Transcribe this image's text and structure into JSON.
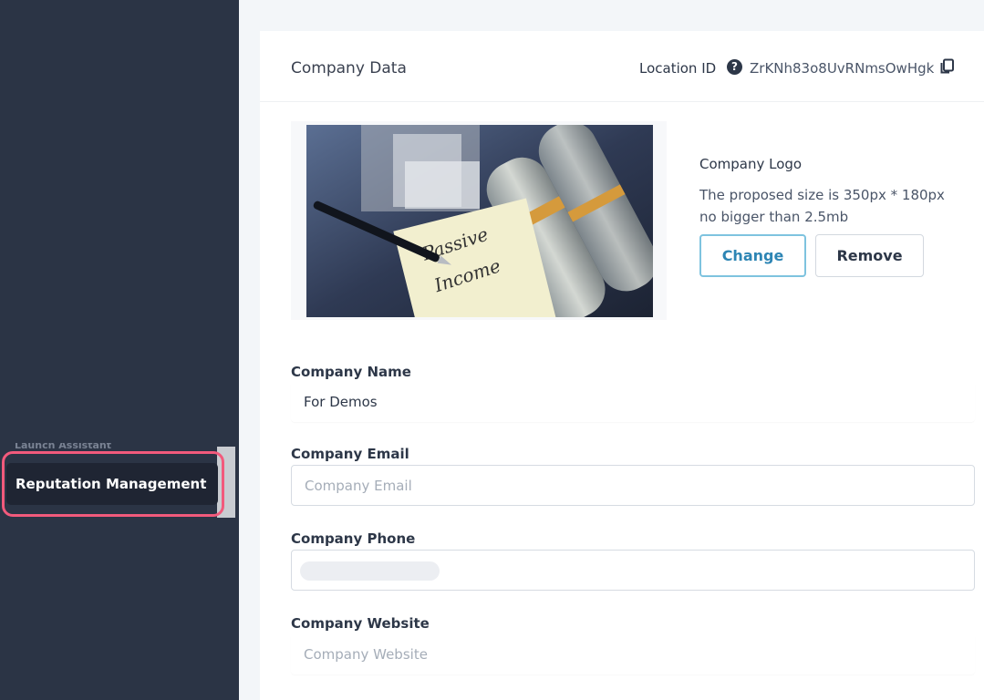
{
  "sidebar": {
    "ghost_item_label": "Launch Assistant",
    "active_item_label": "Reputation Management"
  },
  "card": {
    "title": "Company Data",
    "location_label": "Location ID",
    "location_id": "ZrKNh83o8UvRNmsOwHgk"
  },
  "logo": {
    "image_text": "Passive Income",
    "title": "Company Logo",
    "hint_line1": "The proposed size is 350px * 180px",
    "hint_line2": "no bigger than 2.5mb",
    "change_label": "Change",
    "remove_label": "Remove"
  },
  "fields": {
    "name_label": "Company Name",
    "name_value": "For Demos",
    "email_label": "Company Email",
    "email_placeholder": "Company Email",
    "phone_label": "Company Phone",
    "website_label": "Company Website",
    "website_placeholder": "Company Website"
  },
  "colors": {
    "sidebar_bg": "#2b3445",
    "highlight": "#f25a7c",
    "accent": "#2d85b4"
  }
}
